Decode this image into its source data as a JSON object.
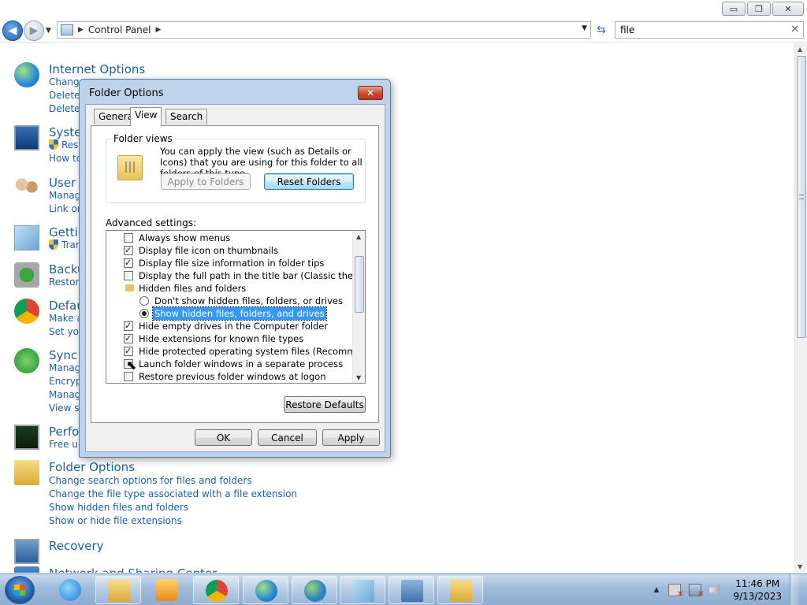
{
  "window": {
    "minimize": "▭",
    "maximize": "❐",
    "close": "✕"
  },
  "nav": {
    "breadcrumb": "Control Panel",
    "search_value": "file",
    "search_clear": "✕"
  },
  "items": [
    {
      "title": "Internet Options",
      "icon": "internet-options-icon",
      "links": [
        "Change",
        "Delete",
        "Delete"
      ]
    },
    {
      "title": "Syste",
      "icon": "system-icon",
      "links": [
        "Rest",
        "How to"
      ]
    },
    {
      "title": "User A",
      "icon": "user-accounts-icon",
      "links": [
        "Manag",
        "Link on"
      ]
    },
    {
      "title": "Gettin",
      "icon": "getting-started-icon",
      "links": [
        "Tran"
      ]
    },
    {
      "title": "Backu",
      "icon": "backup-icon",
      "links": [
        "Restore"
      ]
    },
    {
      "title": "Defau",
      "icon": "default-programs-icon",
      "links": [
        "Make a",
        "Set you"
      ]
    },
    {
      "title": "Sync",
      "icon": "sync-center-icon",
      "links": [
        "Manag",
        "Encrypt",
        "Manag",
        "View sy"
      ]
    },
    {
      "title": "Perfo",
      "icon": "performance-icon",
      "links": [
        "Free up"
      ]
    },
    {
      "title": "Folder Options",
      "icon": "folder-options-icon",
      "links": [
        "Change search options for files and folders",
        "Change the file type associated with a file extension",
        "Show hidden files and folders",
        "Show or hide file extensions"
      ]
    },
    {
      "title": "Recovery",
      "icon": "recovery-icon",
      "links": []
    },
    {
      "title": "Network and Sharing Center",
      "icon": "network-icon",
      "links": []
    }
  ],
  "dialog": {
    "title": "Folder Options",
    "close": "✕",
    "tabs": [
      "General",
      "View",
      "Search"
    ],
    "active_tab": "View",
    "folder_views": {
      "legend": "Folder views",
      "text": "You can apply the view (such as Details or Icons) that you are using for this folder to all folders of this type.",
      "apply_button": "Apply to Folders",
      "reset_button": "Reset Folders"
    },
    "advanced_label": "Advanced settings:",
    "settings": [
      {
        "type": "checkbox",
        "label": "Always show menus",
        "checked": false
      },
      {
        "type": "checkbox",
        "label": "Display file icon on thumbnails",
        "checked": true
      },
      {
        "type": "checkbox",
        "label": "Display file size information in folder tips",
        "checked": true
      },
      {
        "type": "checkbox",
        "label": "Display the full path in the title bar (Classic theme only)",
        "checked": false
      },
      {
        "type": "folder",
        "label": "Hidden files and folders"
      },
      {
        "type": "radio",
        "label": "Don't show hidden files, folders, or drives",
        "checked": false
      },
      {
        "type": "radio",
        "label": "Show hidden files, folders, and drives",
        "checked": true,
        "selected": true
      },
      {
        "type": "checkbox",
        "label": "Hide empty drives in the Computer folder",
        "checked": true
      },
      {
        "type": "checkbox",
        "label": "Hide extensions for known file types",
        "checked": true
      },
      {
        "type": "checkbox",
        "label": "Hide protected operating system files (Recommended)",
        "checked": true
      },
      {
        "type": "checkbox",
        "label": "Launch folder windows in a separate process",
        "checked": false
      },
      {
        "type": "checkbox",
        "label": "Restore previous folder windows at logon",
        "checked": false
      }
    ],
    "restore_defaults": "Restore Defaults",
    "ok": "OK",
    "cancel": "Cancel",
    "apply": "Apply"
  },
  "taskbar": {
    "apps": [
      "internet-explorer",
      "windows-explorer",
      "media-player",
      "chrome",
      "globe",
      "internet-options",
      "notepad",
      "control-panel",
      "folder-options"
    ],
    "time": "11:46 PM",
    "date": "9/13/2023"
  }
}
